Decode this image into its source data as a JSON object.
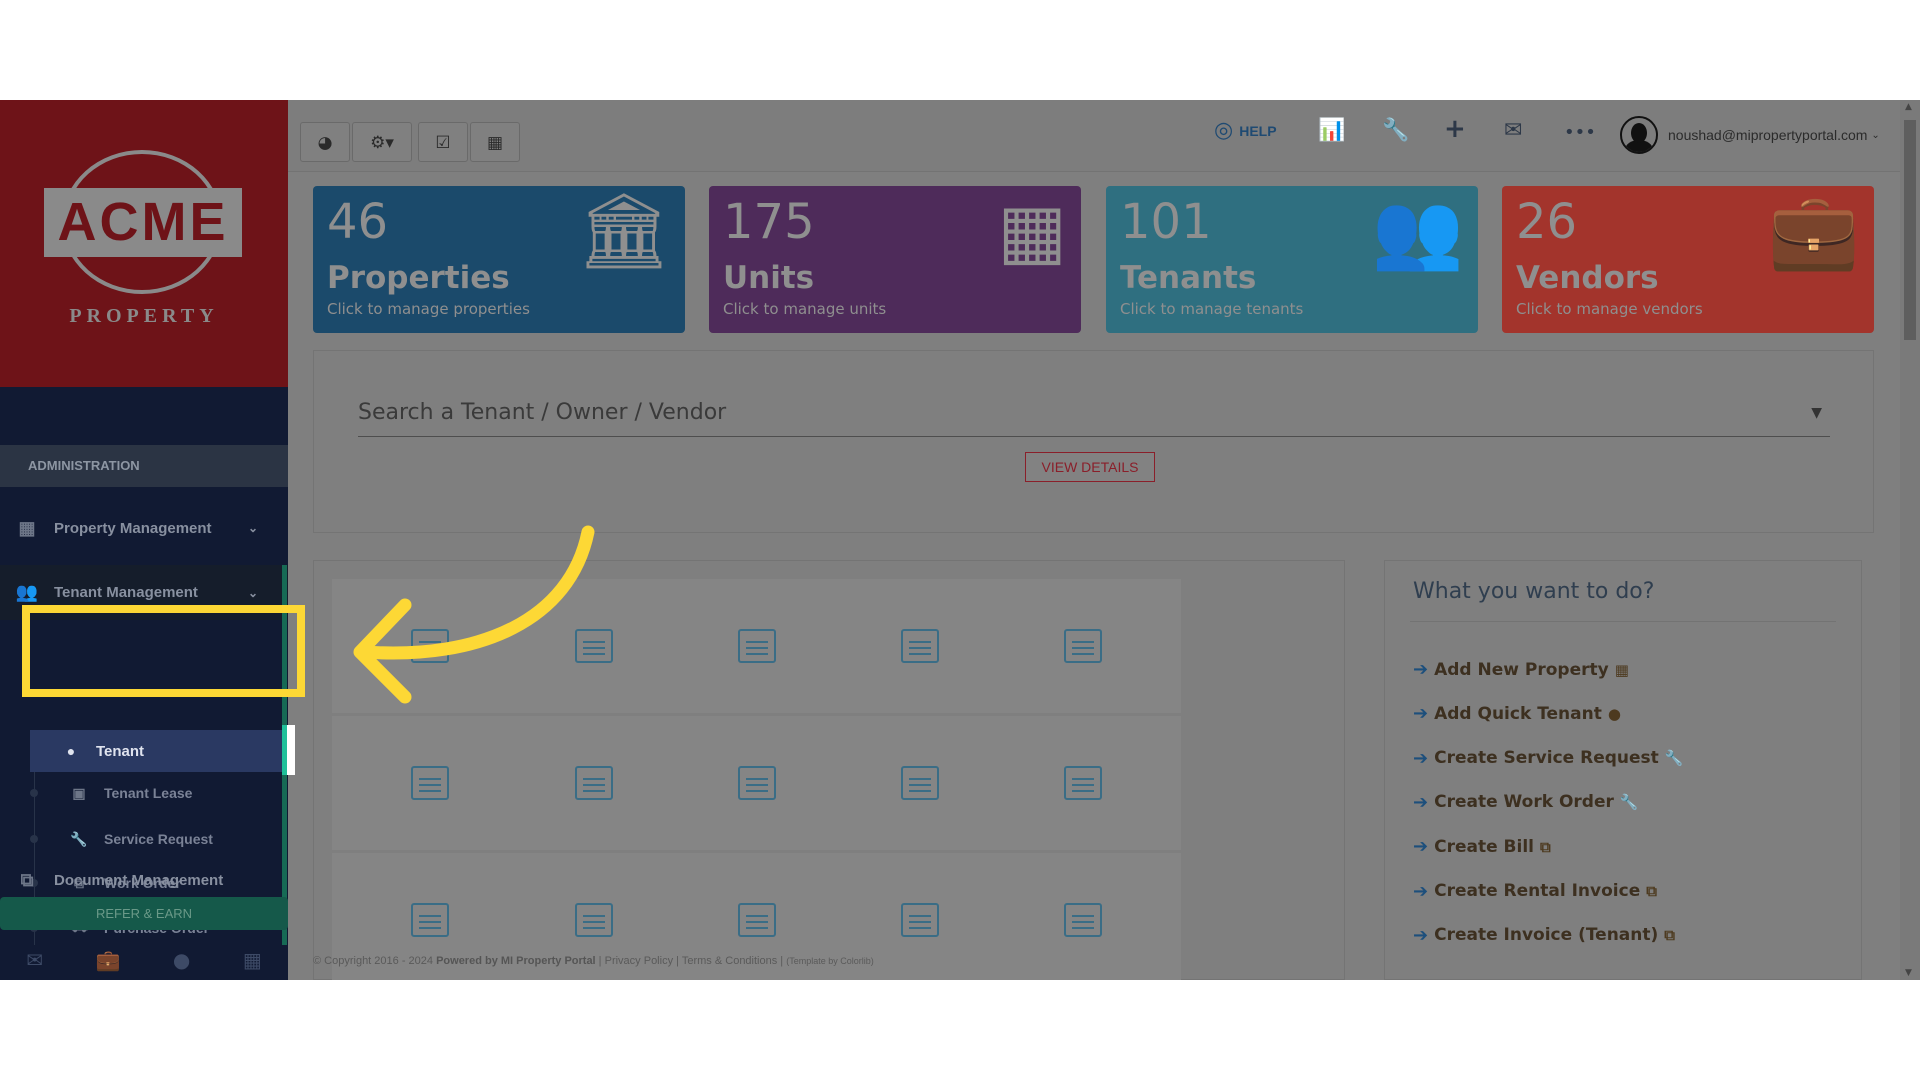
{
  "logo": {
    "name": "ACME",
    "sub": "PROPERTY"
  },
  "sidebar": {
    "section": "ADMINISTRATION",
    "items": [
      {
        "label": "Property Management"
      },
      {
        "label": "Tenant Management"
      },
      {
        "label": "Document Management"
      }
    ],
    "sub_items": [
      {
        "label": "Tenant"
      },
      {
        "label": "Tenant Lease"
      },
      {
        "label": "Service Request"
      },
      {
        "label": "Work Order"
      },
      {
        "label": "Purchase Order"
      }
    ],
    "refer": "REFER & EARN"
  },
  "topbar": {
    "help": "HELP",
    "user": "noushad@mipropertyportal.com"
  },
  "cards": [
    {
      "num": "46",
      "label": "Properties",
      "hint": "Click to manage properties",
      "color": "#1b4a6b"
    },
    {
      "num": "175",
      "label": "Units",
      "hint": "Click to manage units",
      "color": "#4e2b5a"
    },
    {
      "num": "101",
      "label": "Tenants",
      "hint": "Click to manage tenants",
      "color": "#2f6f80"
    },
    {
      "num": "26",
      "label": "Vendors",
      "hint": "Click to manage vendors",
      "color": "#a3342c"
    }
  ],
  "search": {
    "placeholder": "Search a Tenant / Owner / Vendor",
    "button": "VIEW DETAILS"
  },
  "what_to_do": {
    "title": "What you want to do?",
    "actions": [
      {
        "label": "Add New Property",
        "icon": "▦"
      },
      {
        "label": "Add Quick Tenant",
        "icon": "●"
      },
      {
        "label": "Create Service Request",
        "icon": "🔧"
      },
      {
        "label": "Create Work Order",
        "icon": "🔧"
      },
      {
        "label": "Create Bill",
        "icon": "⧉"
      },
      {
        "label": "Create Rental Invoice",
        "icon": "⧉"
      },
      {
        "label": "Create Invoice (Tenant)",
        "icon": "⧉"
      }
    ]
  },
  "footer": {
    "copyright": "© Copyright 2016 - 2024",
    "powered": "Powered by MI Property Portal",
    "privacy": "Privacy Policy",
    "terms": "Terms & Conditions",
    "template": "(Template by Colorlib)"
  }
}
